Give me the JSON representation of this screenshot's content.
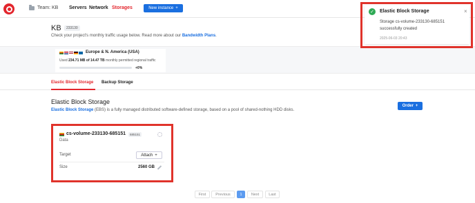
{
  "topbar": {
    "team_label": "Team: KB",
    "nav": [
      "Servers",
      "Network",
      "Storages"
    ],
    "active_nav": "Storages",
    "new_instance_label": "New instance",
    "new_instance_icon": "+"
  },
  "header": {
    "title": "KB",
    "project_id": "233130",
    "description": "Check your project's monthly traffic usage below. Read more about our",
    "description_link": "Bandwidth Plans",
    "description_end": "."
  },
  "region": {
    "flags": [
      "#f2b705",
      "#c8102e",
      "#ffffff",
      "#b22234",
      "#000000",
      "#0066a6"
    ],
    "name": "Europe & N. America (USA)",
    "usage_prefix": "Used",
    "usage_value": "234.71 MB of 14.47 TB",
    "usage_suffix": "monthly permitted regional traffic",
    "usage_percent_label": "+0%",
    "usage_fraction": 0.0
  },
  "tabs": [
    {
      "label": "Elastic Block Storage",
      "active": true
    },
    {
      "label": "Backup Storage",
      "active": false
    }
  ],
  "ebs": {
    "title": "Elastic Block Storage",
    "desc_link": "Elastic Block Storage",
    "desc_rest": "(EBS) is a fully managed distributed software-defined storage, based on a pool of shared-nothing HDD disks.",
    "order_label": "Order",
    "order_icon": "+"
  },
  "volume": {
    "name": "cs-volume-233130-685151",
    "id": "685151",
    "type": "Data",
    "target_label": "Target",
    "attach_label": "Attach",
    "attach_icon": "+",
    "size_label": "Size",
    "size_value": "2560 GB"
  },
  "pagination": [
    "First",
    "Previous",
    "1",
    "Next",
    "Last"
  ],
  "toast": {
    "title": "Elastic Block Storage",
    "message": "Storage cs-volume-233130-685151 successfully created",
    "time": "2025-06-03 20:43",
    "close": "×",
    "check": "✓"
  },
  "colors": {
    "accent": "#e3262d",
    "primary": "#1a6fe0",
    "success": "#2eaa55",
    "highlight": "#e0332b"
  }
}
